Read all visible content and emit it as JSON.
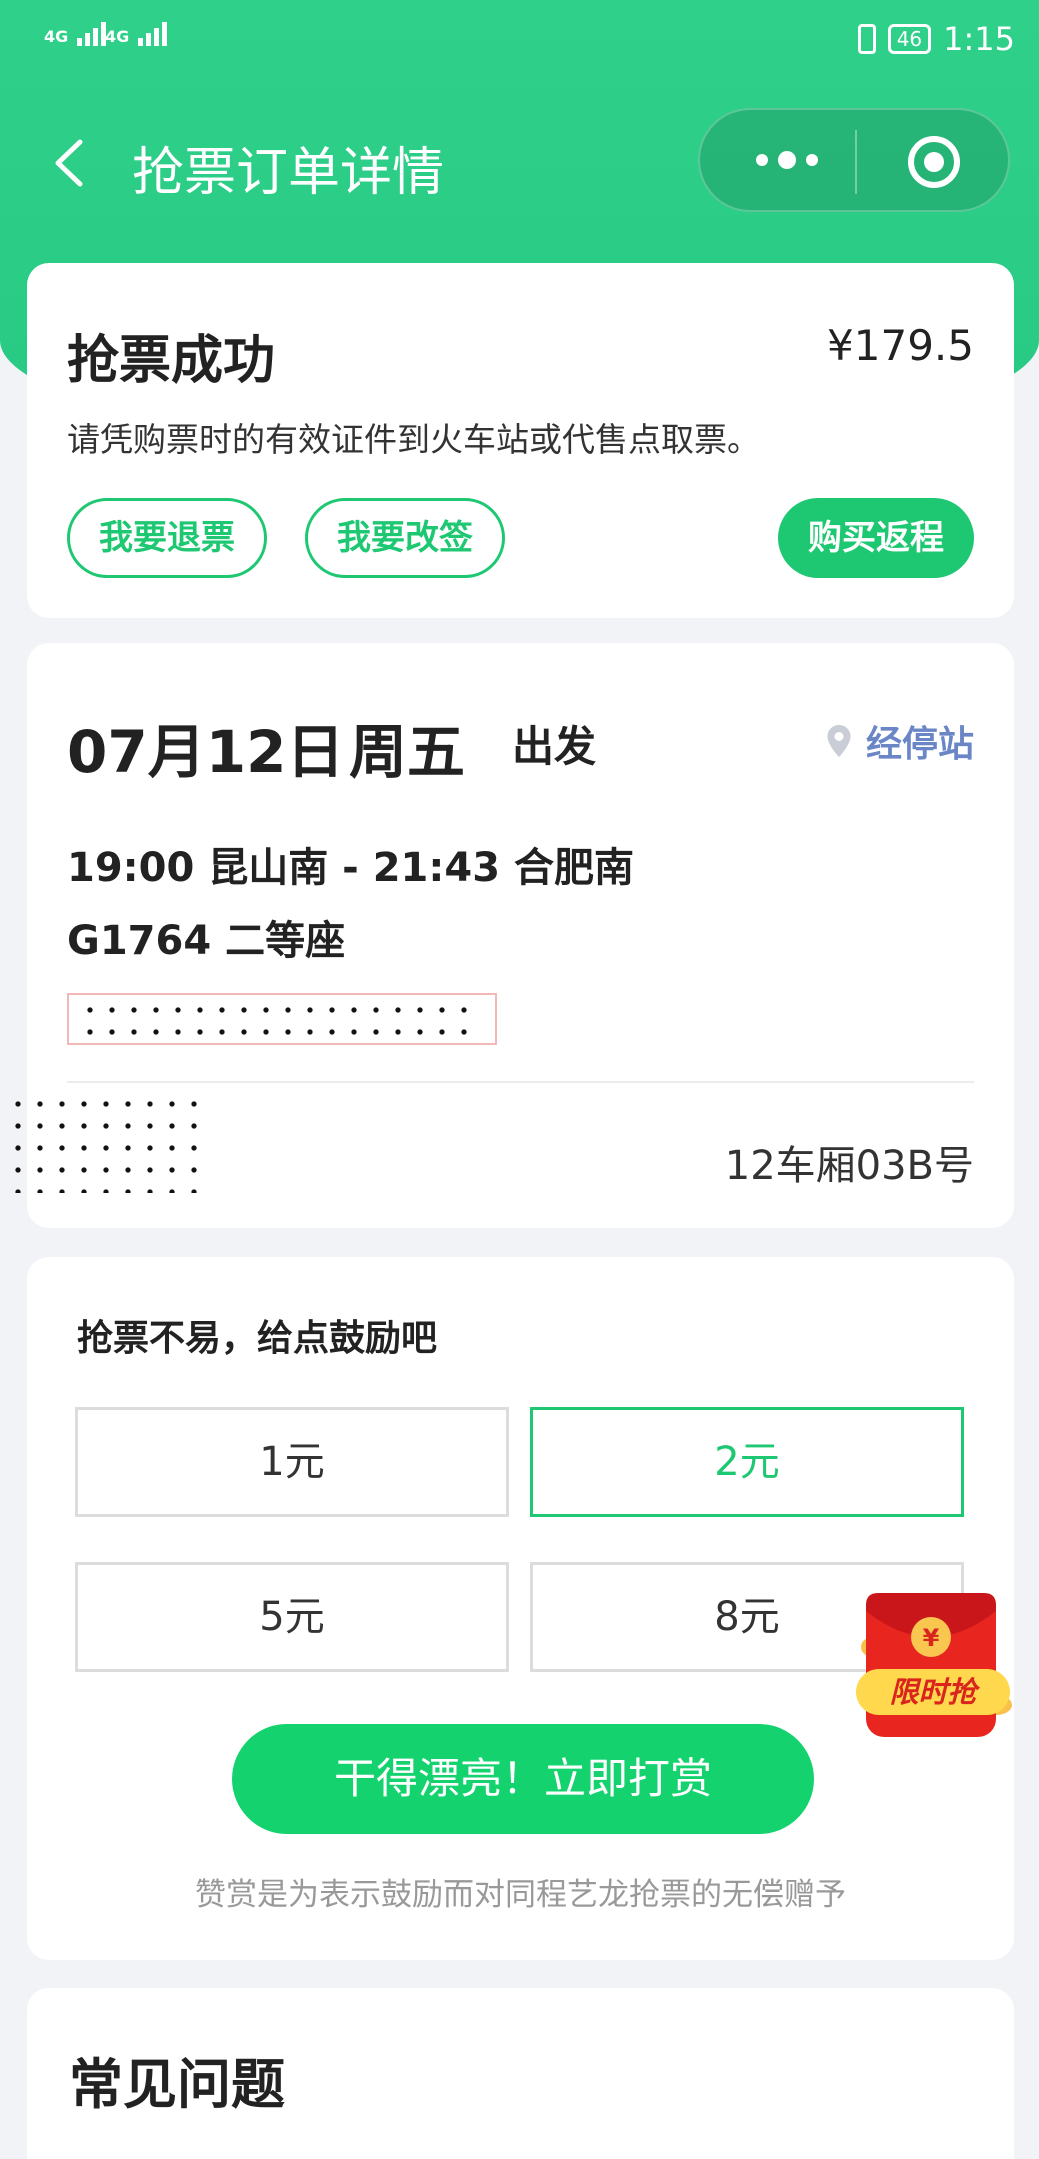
{
  "status_bar": {
    "signal1": "4G",
    "signal2": "4G",
    "battery": "46",
    "time": "1:15"
  },
  "nav": {
    "title": "抢票订单详情",
    "back_icon": "chevron-left-icon",
    "more_icon": "more-dots-icon",
    "close_icon": "target-circle-icon"
  },
  "status_card": {
    "title": "抢票成功",
    "price": "¥179.5",
    "description": "请凭购票时的有效证件到火车站或代售点取票。",
    "refund_label": "我要退票",
    "change_label": "我要改签",
    "return_label": "购买返程"
  },
  "trip_card": {
    "date": "07月12日",
    "weekday": "周五",
    "depart_label": "出发",
    "stops_label": "经停站",
    "route": "19:00 昆山南 - 21:43 合肥南",
    "train": "G1764  二等座",
    "seat": "12车厢03B号"
  },
  "reward_card": {
    "heading": "抢票不易，给点鼓励吧",
    "options": [
      "1元",
      "2元",
      "5元",
      "8元"
    ],
    "selected_index": 1,
    "submit_label": "干得漂亮！立即打赏",
    "note": "赞赏是为表示鼓励而对同程艺龙抢票的无偿赠予"
  },
  "faq": {
    "title": "常见问题"
  },
  "promo": {
    "label": "限时抢",
    "icon": "red-envelope-icon"
  },
  "colors": {
    "brand_green": "#1ec872",
    "header_green": "#2fd08a",
    "link_blue": "#6b86c7",
    "background": "#f2f3f7"
  }
}
